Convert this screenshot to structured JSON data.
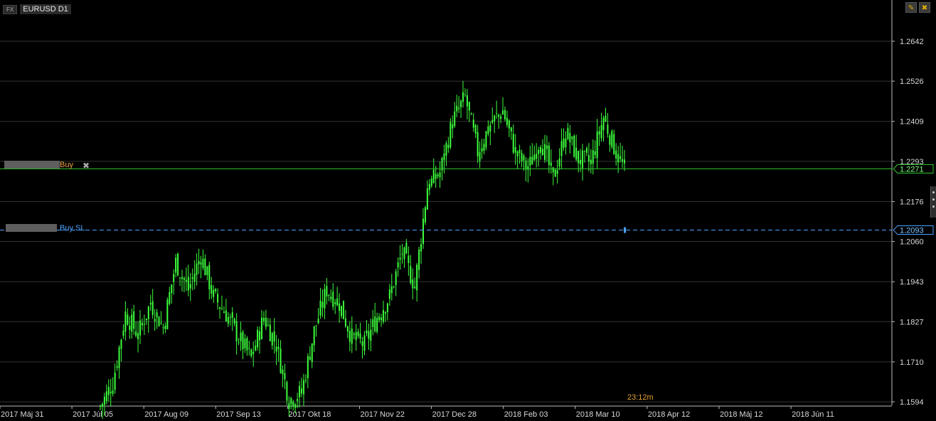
{
  "header": {
    "badge": "FX",
    "symbol": "EURUSD D1"
  },
  "toolbar": {
    "edit_icon": "pencil-icon",
    "close_icon": "close-icon",
    "edit_glyph": "✎",
    "close_glyph": "✖"
  },
  "orders": {
    "buy": {
      "label": "Buy",
      "price": "1.2271",
      "color": "#f0a040"
    },
    "buy_sl": {
      "label": "Buy SL",
      "price": "1.2093",
      "color": "#4aa3ff"
    }
  },
  "timer": "23:12m",
  "colors": {
    "candles": "#3cff3c",
    "buy_line": "#2ecc2e",
    "sl_line": "#4aa3ff",
    "grid": "#333333"
  },
  "chart_data": {
    "type": "candlestick",
    "symbol": "EURUSD",
    "timeframe": "D1",
    "ylim": [
      1.15941,
      1.27
    ],
    "y_ticks": [
      "1.2642",
      "1.2526",
      "1.2409",
      "1.2293",
      "1.2176",
      "1.2060",
      "1.1943",
      "1.1827",
      "1.1710",
      "1.1594"
    ],
    "x_ticks": [
      "2017 Máj 31",
      "2017 Júl 05",
      "2017 Aug 09",
      "2017 Sep 13",
      "2017 Okt 18",
      "2017 Nov 22",
      "2017 Dec 28",
      "2018 Feb 03",
      "2018 Mar 10",
      "2018 Apr 12",
      "2018 Máj 12",
      "2018 Jún 11"
    ],
    "current_price": 1.22712,
    "stop_loss": 1.20931,
    "close_path": [
      [
        0,
        1.158
      ],
      [
        6,
        1.165
      ],
      [
        12,
        1.185
      ],
      [
        18,
        1.179
      ],
      [
        24,
        1.188
      ],
      [
        30,
        1.181
      ],
      [
        36,
        1.2
      ],
      [
        42,
        1.192
      ],
      [
        48,
        1.202
      ],
      [
        54,
        1.19
      ],
      [
        60,
        1.185
      ],
      [
        66,
        1.178
      ],
      [
        72,
        1.172
      ],
      [
        78,
        1.184
      ],
      [
        84,
        1.176
      ],
      [
        90,
        1.16
      ],
      [
        96,
        1.162
      ],
      [
        102,
        1.18
      ],
      [
        108,
        1.192
      ],
      [
        114,
        1.188
      ],
      [
        120,
        1.178
      ],
      [
        126,
        1.176
      ],
      [
        132,
        1.184
      ],
      [
        138,
        1.19
      ],
      [
        144,
        1.203
      ],
      [
        150,
        1.193
      ],
      [
        156,
        1.222
      ],
      [
        162,
        1.226
      ],
      [
        168,
        1.241
      ],
      [
        174,
        1.248
      ],
      [
        180,
        1.232
      ],
      [
        186,
        1.24
      ],
      [
        192,
        1.244
      ],
      [
        198,
        1.232
      ],
      [
        204,
        1.227
      ],
      [
        210,
        1.236
      ],
      [
        216,
        1.224
      ],
      [
        222,
        1.238
      ],
      [
        228,
        1.23
      ],
      [
        234,
        1.229
      ],
      [
        240,
        1.242
      ],
      [
        246,
        1.232
      ],
      [
        250,
        1.2271
      ]
    ],
    "bar_count": 251
  }
}
